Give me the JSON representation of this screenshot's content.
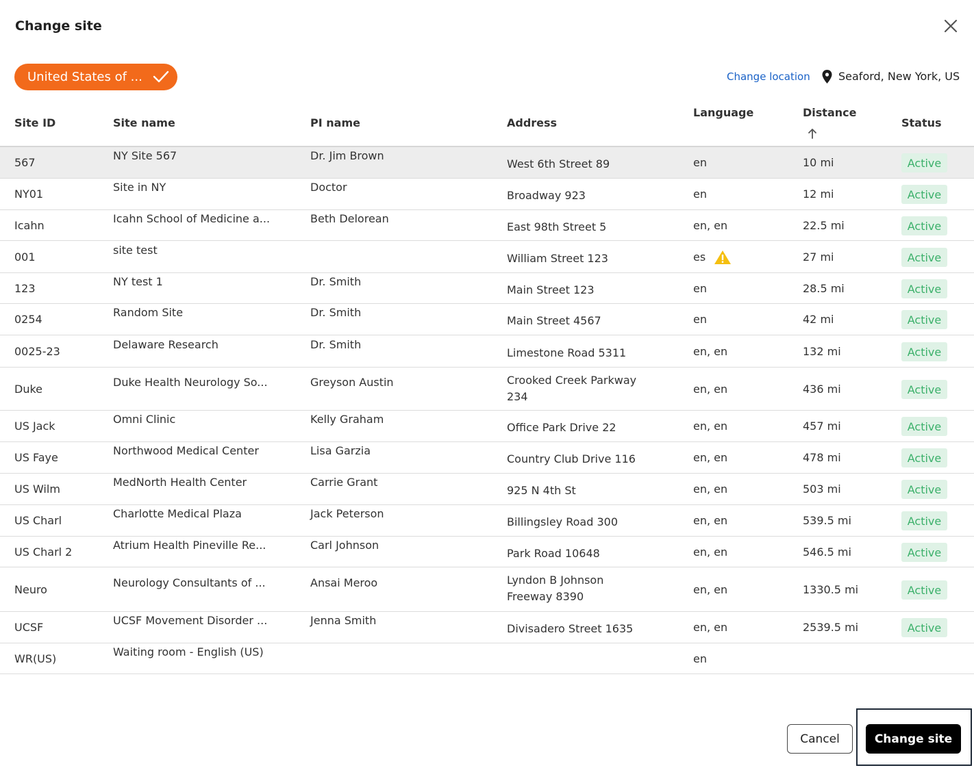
{
  "dialog": {
    "title": "Change site"
  },
  "filter": {
    "country_chip": "United States of ..."
  },
  "location": {
    "change_link": "Change location",
    "current": "Seaford, New York, US"
  },
  "table": {
    "columns": {
      "site_id": "Site ID",
      "site_name": "Site name",
      "pi_name": "PI name",
      "address": "Address",
      "language": "Language",
      "distance": "Distance",
      "status": "Status"
    },
    "rows": [
      {
        "site_id": "567",
        "site_name": "NY Site 567",
        "pi_name": "Dr. Jim Brown",
        "address": "West 6th Street 89",
        "language": "en",
        "distance": "10 mi",
        "status": "Active",
        "selected": true
      },
      {
        "site_id": "NY01",
        "site_name": "Site in NY",
        "pi_name": "Doctor",
        "address": "Broadway 923",
        "language": "en",
        "distance": "12 mi",
        "status": "Active"
      },
      {
        "site_id": "Icahn",
        "site_name": "Icahn School of Medicine a...",
        "pi_name": "Beth Delorean",
        "address": "East 98th Street 5",
        "language": "en, en",
        "distance": "22.5 mi",
        "status": "Active"
      },
      {
        "site_id": "001",
        "site_name": "site test",
        "pi_name": "",
        "address": "William Street 123",
        "language": "es",
        "distance": "27 mi",
        "status": "Active",
        "warning": true
      },
      {
        "site_id": "123",
        "site_name": "NY test 1",
        "pi_name": "Dr. Smith",
        "address": "Main Street 123",
        "language": "en",
        "distance": "28.5 mi",
        "status": "Active"
      },
      {
        "site_id": "0254",
        "site_name": "Random Site",
        "pi_name": "Dr. Smith",
        "address": "Main Street 4567",
        "language": "en",
        "distance": "42 mi",
        "status": "Active"
      },
      {
        "site_id": "0025-23",
        "site_name": "Delaware Research",
        "pi_name": "Dr. Smith",
        "address": "Limestone Road 5311",
        "language": "en, en",
        "distance": "132 mi",
        "status": "Active"
      },
      {
        "site_id": "Duke",
        "site_name": "Duke Health Neurology So...",
        "pi_name": "Greyson Austin",
        "address": "Crooked Creek Parkway 234",
        "language": "en, en",
        "distance": "436 mi",
        "status": "Active"
      },
      {
        "site_id": "US Jack",
        "site_name": "Omni Clinic",
        "pi_name": "Kelly Graham",
        "address": "Office Park Drive 22",
        "language": "en, en",
        "distance": "457 mi",
        "status": "Active"
      },
      {
        "site_id": "US Faye",
        "site_name": "Northwood Medical Center",
        "pi_name": "Lisa Garzia",
        "address": "Country Club Drive 116",
        "language": "en, en",
        "distance": "478 mi",
        "status": "Active"
      },
      {
        "site_id": "US Wilm",
        "site_name": "MedNorth Health Center",
        "pi_name": "Carrie Grant",
        "address": "925 N 4th St",
        "language": "en, en",
        "distance": "503 mi",
        "status": "Active"
      },
      {
        "site_id": "US Charl",
        "site_name": "Charlotte Medical Plaza",
        "pi_name": "Jack Peterson",
        "address": "Billingsley Road 300",
        "language": "en, en",
        "distance": "539.5 mi",
        "status": "Active"
      },
      {
        "site_id": "US Charl 2",
        "site_name": "Atrium Health Pineville Re...",
        "pi_name": "Carl Johnson",
        "address": "Park Road 10648",
        "language": "en, en",
        "distance": "546.5 mi",
        "status": "Active"
      },
      {
        "site_id": "Neuro",
        "site_name": "Neurology Consultants of ...",
        "pi_name": "Ansai Meroo",
        "address": "Lyndon B Johnson Freeway 8390",
        "language": "en, en",
        "distance": "1330.5 mi",
        "status": "Active"
      },
      {
        "site_id": "UCSF",
        "site_name": "UCSF Movement Disorder ...",
        "pi_name": "Jenna Smith",
        "address": "Divisadero Street 1635",
        "language": "en, en",
        "distance": "2539.5 mi",
        "status": "Active"
      },
      {
        "site_id": "WR(US)",
        "site_name": "Waiting room - English (US)",
        "pi_name": "",
        "address": "",
        "language": "en",
        "distance": "",
        "status": ""
      }
    ]
  },
  "footer": {
    "cancel_label": "Cancel",
    "confirm_label": "Change site"
  }
}
